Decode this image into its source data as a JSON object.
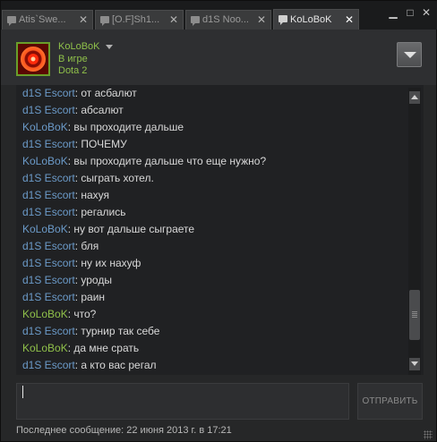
{
  "tabs": [
    {
      "label": "Atis`Swe...",
      "close": "✕",
      "active": false
    },
    {
      "label": "[O.F]Sh1...",
      "close": "✕",
      "active": false
    },
    {
      "label": "d1S Noo...",
      "close": "✕",
      "active": false
    },
    {
      "label": "KoLoBoK",
      "close": "✕",
      "active": true
    }
  ],
  "window_controls": {
    "minimize": "▁",
    "maximize": "□",
    "close": "✕"
  },
  "header": {
    "username": "KoLoBoK",
    "status": "В игре",
    "game": "Dota 2"
  },
  "messages": [
    {
      "who": "d1S Escort",
      "me": false,
      "text": "от асбалют"
    },
    {
      "who": "d1S Escort",
      "me": false,
      "text": "абсалют"
    },
    {
      "who": "KoLoBoK",
      "me": false,
      "text": "вы проходите дальше"
    },
    {
      "who": "d1S Escort",
      "me": false,
      "text": "ПОЧЕМУ"
    },
    {
      "who": "KoLoBoK",
      "me": false,
      "text": "вы проходите дальше что еще нужно?"
    },
    {
      "who": "d1S Escort",
      "me": false,
      "text": "сыграть хотел."
    },
    {
      "who": "d1S Escort",
      "me": false,
      "text": "нахуя"
    },
    {
      "who": "d1S Escort",
      "me": false,
      "text": "регались"
    },
    {
      "who": "KoLoBoK",
      "me": false,
      "text": "ну вот дальше сыграете"
    },
    {
      "who": "d1S Escort",
      "me": false,
      "text": "бля"
    },
    {
      "who": "d1S Escort",
      "me": false,
      "text": "ну их нахуф"
    },
    {
      "who": "d1S Escort",
      "me": false,
      "text": "уроды"
    },
    {
      "who": "d1S Escort",
      "me": false,
      "text": "раин"
    },
    {
      "who": "KoLoBoK",
      "me": true,
      "text": "что?"
    },
    {
      "who": "d1S Escort",
      "me": false,
      "text": "турнир так себе"
    },
    {
      "who": "KoLoBoK",
      "me": true,
      "text": "да мне срать"
    },
    {
      "who": "d1S Escort",
      "me": false,
      "text": "а кто вас регал"
    }
  ],
  "message_separator": ": ",
  "input": {
    "value": "",
    "placeholder": ""
  },
  "send_label": "ОТПРАВИТЬ",
  "last_message": "Последнее сообщение: 22 июня 2013 г. в 17:21",
  "colors": {
    "friend_name": "#6b9ac8",
    "self_name_ingame": "#8fc04a",
    "background": "#262728",
    "chat_background": "#202123"
  },
  "icons": {
    "tab": "chat-bubble-icon",
    "dropdown": "chevron-down-icon",
    "scroll_up": "arrow-up-icon",
    "scroll_down": "arrow-down-icon"
  }
}
